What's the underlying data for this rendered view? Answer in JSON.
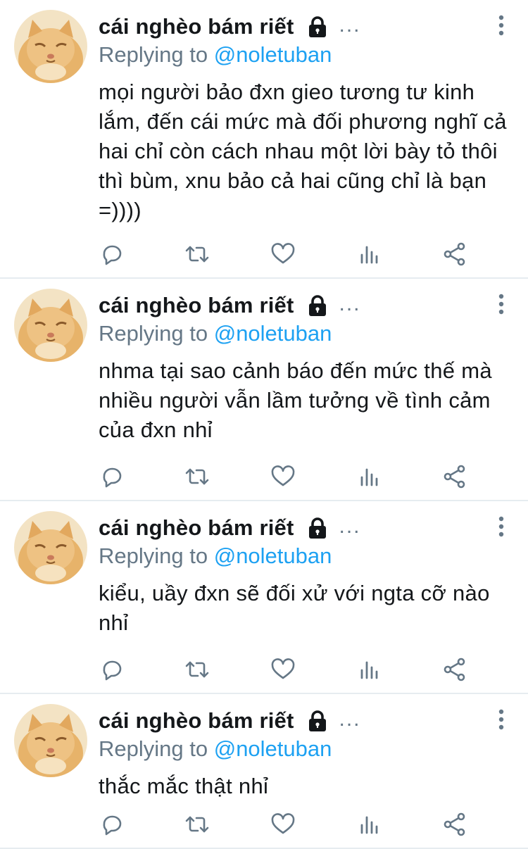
{
  "colors": {
    "name": "#14171a",
    "secondary": "#657786",
    "link": "#1da1f2",
    "divider": "#e6ecf0",
    "icon": "#657786"
  },
  "icons": {
    "lock": "lock-icon",
    "more": "vertical-ellipsis-icon",
    "reply": "reply-icon",
    "retweet": "retweet-icon",
    "like": "heart-icon",
    "analytics": "analytics-icon",
    "share": "share-icon"
  },
  "tweets": [
    {
      "display_name": "cái nghèo bám riết",
      "ellipsis": "...",
      "replying_prefix": "Replying to",
      "replying_handle": "@noletuban",
      "text": "mọi người bảo đxn gieo tương tư kinh lắm, đến cái mức mà đối phương nghĩ cả hai chỉ còn cách nhau một lời bày tỏ thôi thì bùm, xnu bảo cả hai cũng chỉ là bạn =))))"
    },
    {
      "display_name": "cái nghèo bám riết",
      "ellipsis": "...",
      "replying_prefix": "Replying to",
      "replying_handle": "@noletuban",
      "text": "nhma tại sao cảnh báo đến mức thế mà nhiều người vẫn lầm tưởng về tình cảm của đxn nhỉ"
    },
    {
      "display_name": "cái nghèo bám riết",
      "ellipsis": "...",
      "replying_prefix": "Replying to",
      "replying_handle": "@noletuban",
      "text": "kiểu, uầy đxn sẽ đối xử với ngta cỡ nào nhỉ"
    },
    {
      "display_name": "cái nghèo bám riết",
      "ellipsis": "...",
      "replying_prefix": "Replying to",
      "replying_handle": "@noletuban",
      "text": "thắc mắc thật nhỉ"
    }
  ]
}
